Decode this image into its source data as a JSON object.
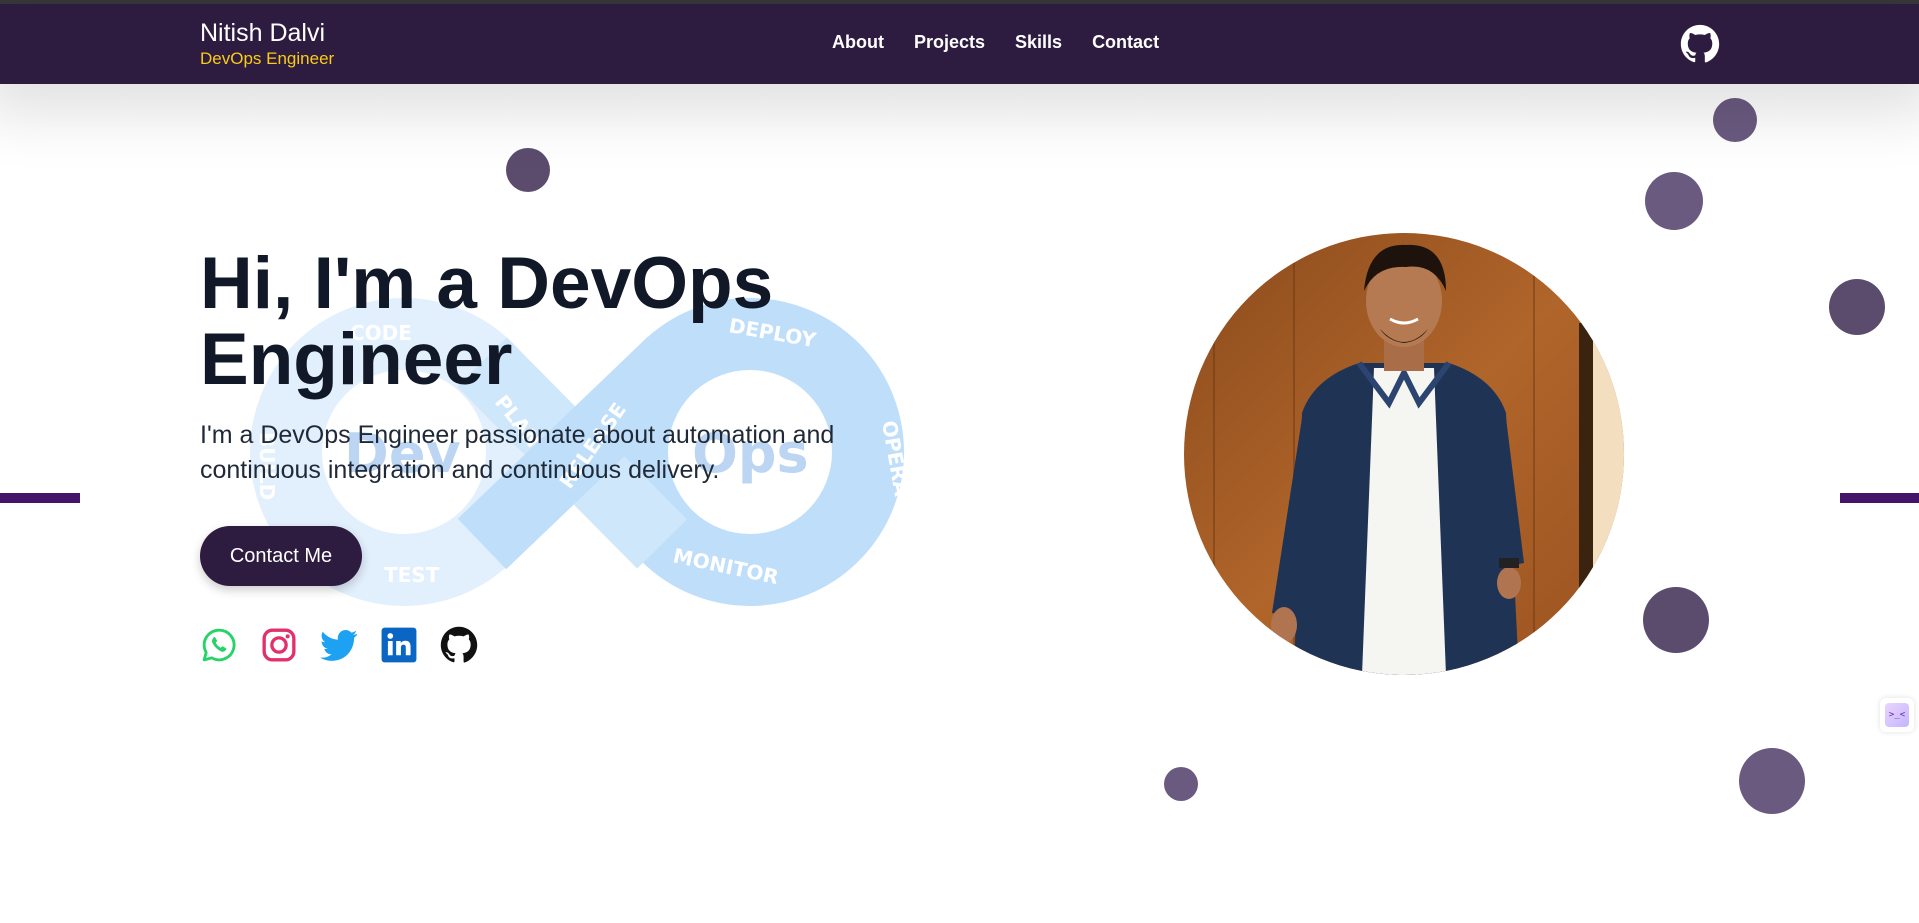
{
  "header": {
    "name": "Nitish Dalvi",
    "role": "DevOps Engineer",
    "nav": [
      {
        "label": "About"
      },
      {
        "label": "Projects"
      },
      {
        "label": "Skills"
      },
      {
        "label": "Contact"
      }
    ],
    "github_icon": "github-icon"
  },
  "hero": {
    "headline": "Hi, I'm a DevOps Engineer",
    "description": "I'm a DevOps Engineer passionate about automation and continuous integration and continuous delivery.",
    "cta_label": "Contact Me",
    "background_graphic": {
      "center_left": "Dev",
      "center_right": "Ops",
      "stages": [
        "CODE",
        "PLAN",
        "BUILD",
        "TEST",
        "RELEASE",
        "DEPLOY",
        "OPERATE",
        "MONITOR"
      ]
    },
    "socials": [
      {
        "icon": "whatsapp-icon",
        "color": "#25d366"
      },
      {
        "icon": "instagram-icon",
        "color": "#e1306c"
      },
      {
        "icon": "twitter-icon",
        "color": "#1da1f2"
      },
      {
        "icon": "linkedin-icon",
        "color": "#0a66c2"
      },
      {
        "icon": "github-icon",
        "color": "#111111"
      }
    ],
    "profile_photo": "profile-photo"
  },
  "side_widget_icon": "assistant-icon",
  "colors": {
    "nav_bg": "#2d1b40",
    "accent_yellow": "#facc15",
    "bubble": "#5b4c6e",
    "accent_bar": "#44136a"
  }
}
